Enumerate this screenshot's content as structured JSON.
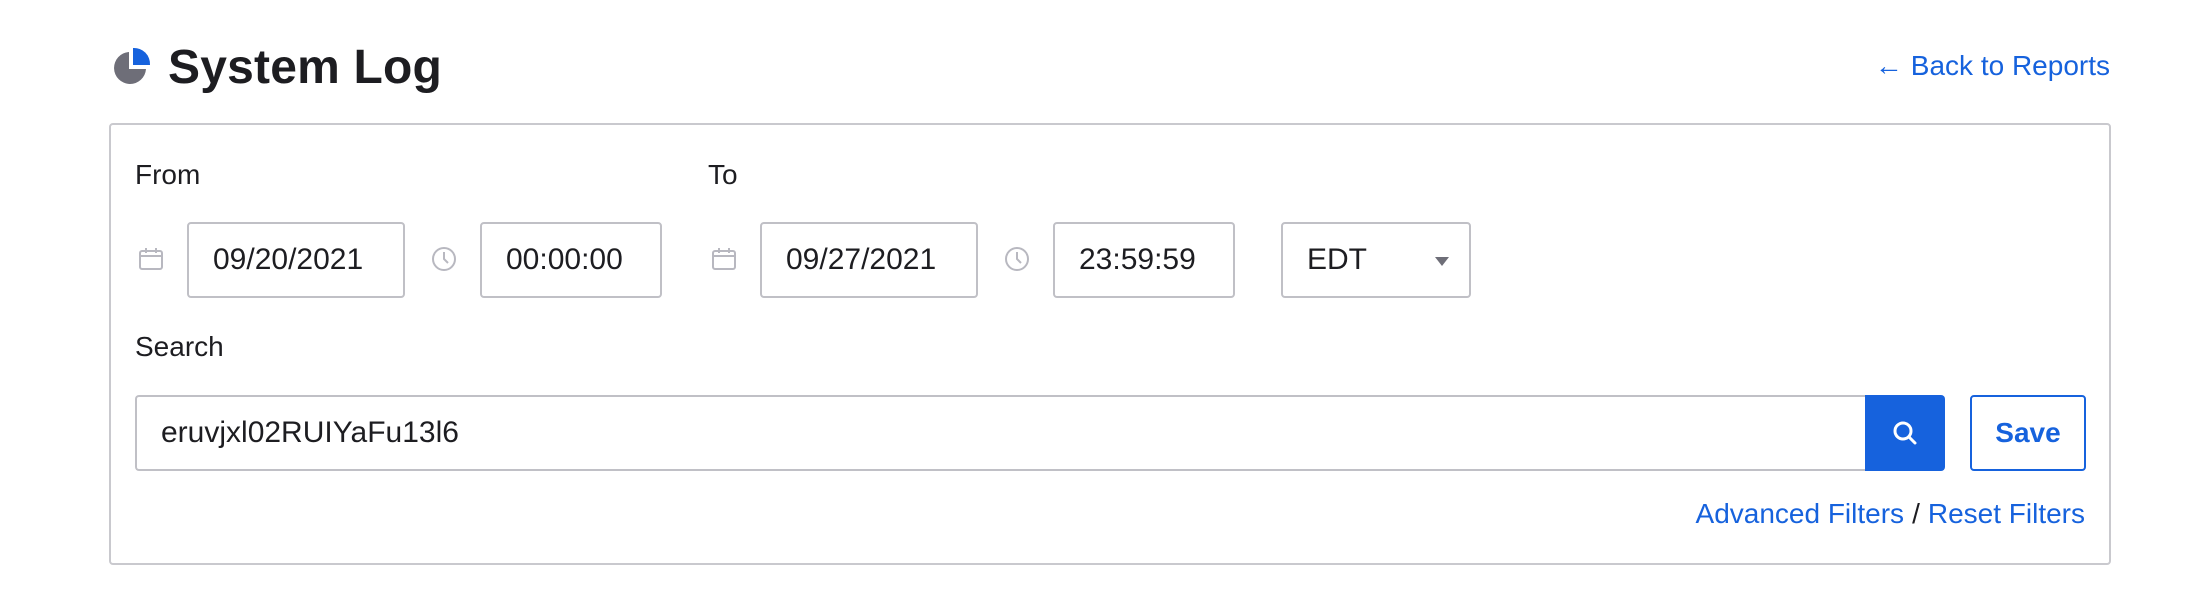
{
  "header": {
    "title": "System Log",
    "icon": "pie-chart-icon",
    "back_link_arrow": "←",
    "back_link_label": "Back to Reports"
  },
  "filters": {
    "from_label": "From",
    "to_label": "To",
    "from_date": "09/20/2021",
    "from_time": "00:00:00",
    "to_date": "09/27/2021",
    "to_time": "23:59:59",
    "timezone": "EDT",
    "date_icon": "calendar-icon",
    "time_icon": "clock-icon"
  },
  "search": {
    "label": "Search",
    "value": "eruvjxl02RUIYaFu13l6",
    "button_icon": "search-icon",
    "save_label": "Save"
  },
  "links": {
    "advanced_filters": "Advanced Filters",
    "separator": "/",
    "reset_filters": "Reset Filters"
  },
  "colors": {
    "accent": "#1662dd",
    "text": "#1d1d21",
    "border": "#c0c0c6",
    "icon_gray": "#6e6e78"
  }
}
